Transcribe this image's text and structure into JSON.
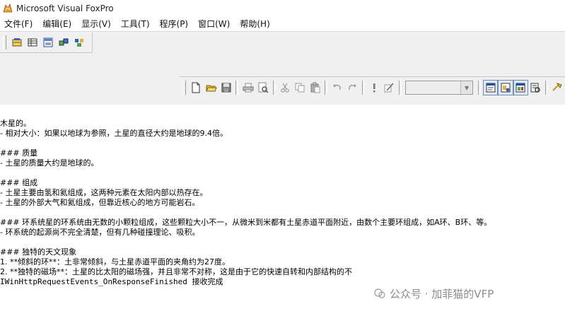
{
  "window": {
    "title": "Microsoft Visual FoxPro"
  },
  "menu": [
    "文件(F)",
    "编辑(E)",
    "显示(V)",
    "工具(T)",
    "程序(P)",
    "窗口(W)",
    "帮助(H)"
  ],
  "toolbar_main": {
    "icons": [
      "form-designer-icon",
      "browse-icon",
      "report-icon",
      "data-session-icon",
      "project-manager-icon"
    ]
  },
  "toolbar_standard": {
    "icons": [
      "new-icon",
      "open-icon",
      "save-icon",
      "print-icon",
      "print-preview-icon",
      "cut-icon",
      "copy-icon",
      "paste-icon",
      "undo-icon",
      "redo-icon",
      "run-icon",
      "modify-icon",
      "command-window-icon",
      "data-session-window-icon",
      "properties-icon",
      "code-icon",
      "help-icon"
    ],
    "combo_value": ""
  },
  "content": {
    "lines": [
      "木星的。",
      "- 相对大小：如果以地球为参照，土星的直径大约是地球的9.4倍。",
      "",
      "### 质量",
      "- 土星的质量大约是地球的。",
      "",
      "### 组成",
      "- 土星主要由氢和氦组成，这两种元素在太阳内部以热存在。",
      "- 土星的外部大气和氦组成，但靠近核心的地方可能岩石。",
      "",
      "### 环系统星的环系统由无数的小颗粒组成，这些颗粒大小不一，从微米到米都有土星赤道平面附近，由数个主要环组成，如A环、B环、等。",
      "- 环系统的起源尚不完全清楚，但有几种碰撞理论、吸积。",
      "",
      "### 独特的天文现象",
      "1. **倾斜的环**：土非常倾斜，与土星赤道平面的夹角约为27度。",
      "2. **独特的磁场**：土星的比太阳的磁场强，并且非常不对称，这是由于它的快速自转和内部结构的不",
      "IWinHttpRequestEvents_OnResponseFinished 接收完成"
    ]
  },
  "watermark": {
    "text": "公众号 · 加菲猫的VFP"
  }
}
